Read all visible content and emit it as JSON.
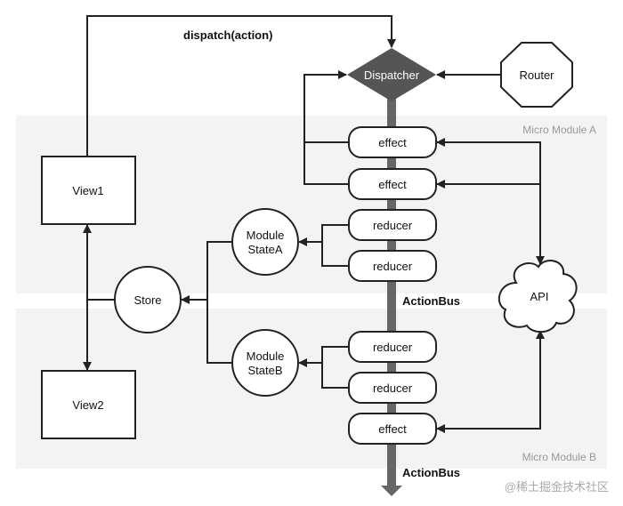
{
  "nodes": {
    "dispatcher": "Dispatcher",
    "router": "Router",
    "view1": "View1",
    "view2": "View2",
    "store": "Store",
    "module_state_a": [
      "Module",
      "StateA"
    ],
    "module_state_b": [
      "Module",
      "StateB"
    ],
    "api": "API",
    "a_effect_1": "effect",
    "a_effect_2": "effect",
    "a_reducer_1": "reducer",
    "a_reducer_2": "reducer",
    "b_reducer_1": "reducer",
    "b_reducer_2": "reducer",
    "b_effect_1": "effect"
  },
  "labels": {
    "dispatch": "dispatch(action)",
    "actionbus_a": "ActionBus",
    "actionbus_b": "ActionBus"
  },
  "regions": {
    "a": "Micro Module A",
    "b": "Micro Module B"
  },
  "watermark": "@稀土掘金技术社区",
  "colors": {
    "region_bg": "#f3f3f3",
    "bus": "#666666",
    "dispatcher": "#555555"
  }
}
